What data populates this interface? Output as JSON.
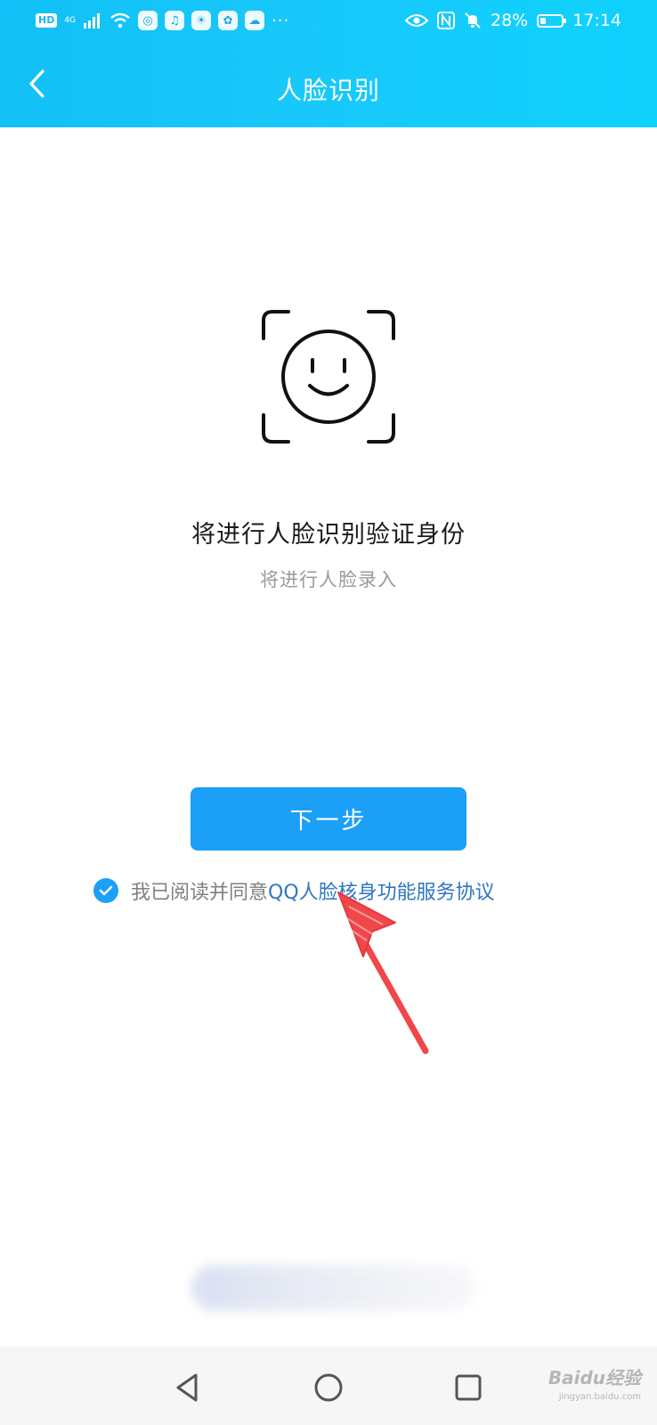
{
  "status_bar": {
    "network_badge": "HD",
    "network_type": "4G",
    "battery_percent": "28%",
    "battery_level": 0.28,
    "time": "17:14",
    "overflow": "···"
  },
  "header": {
    "title": "人脸识别",
    "back_icon": "chevron-left-icon"
  },
  "main": {
    "icon": "face-scan-icon",
    "heading": "将进行人脸识别验证身份",
    "subheading": "将进行人脸录入",
    "next_button_label": "下一步"
  },
  "agreement": {
    "checked": true,
    "prefix": "我已阅读并同意",
    "link": "QQ人脸核身功能服务协议"
  },
  "watermark": {
    "brand": "Baidu经验",
    "url": "jingyan.baidu.com"
  },
  "colors": {
    "header_gradient_start": "#11c0f6",
    "header_gradient_end": "#0fd2fd",
    "primary_button": "#1c9ff6",
    "link": "#2f76c2",
    "annotation_arrow": "#f0474a"
  }
}
